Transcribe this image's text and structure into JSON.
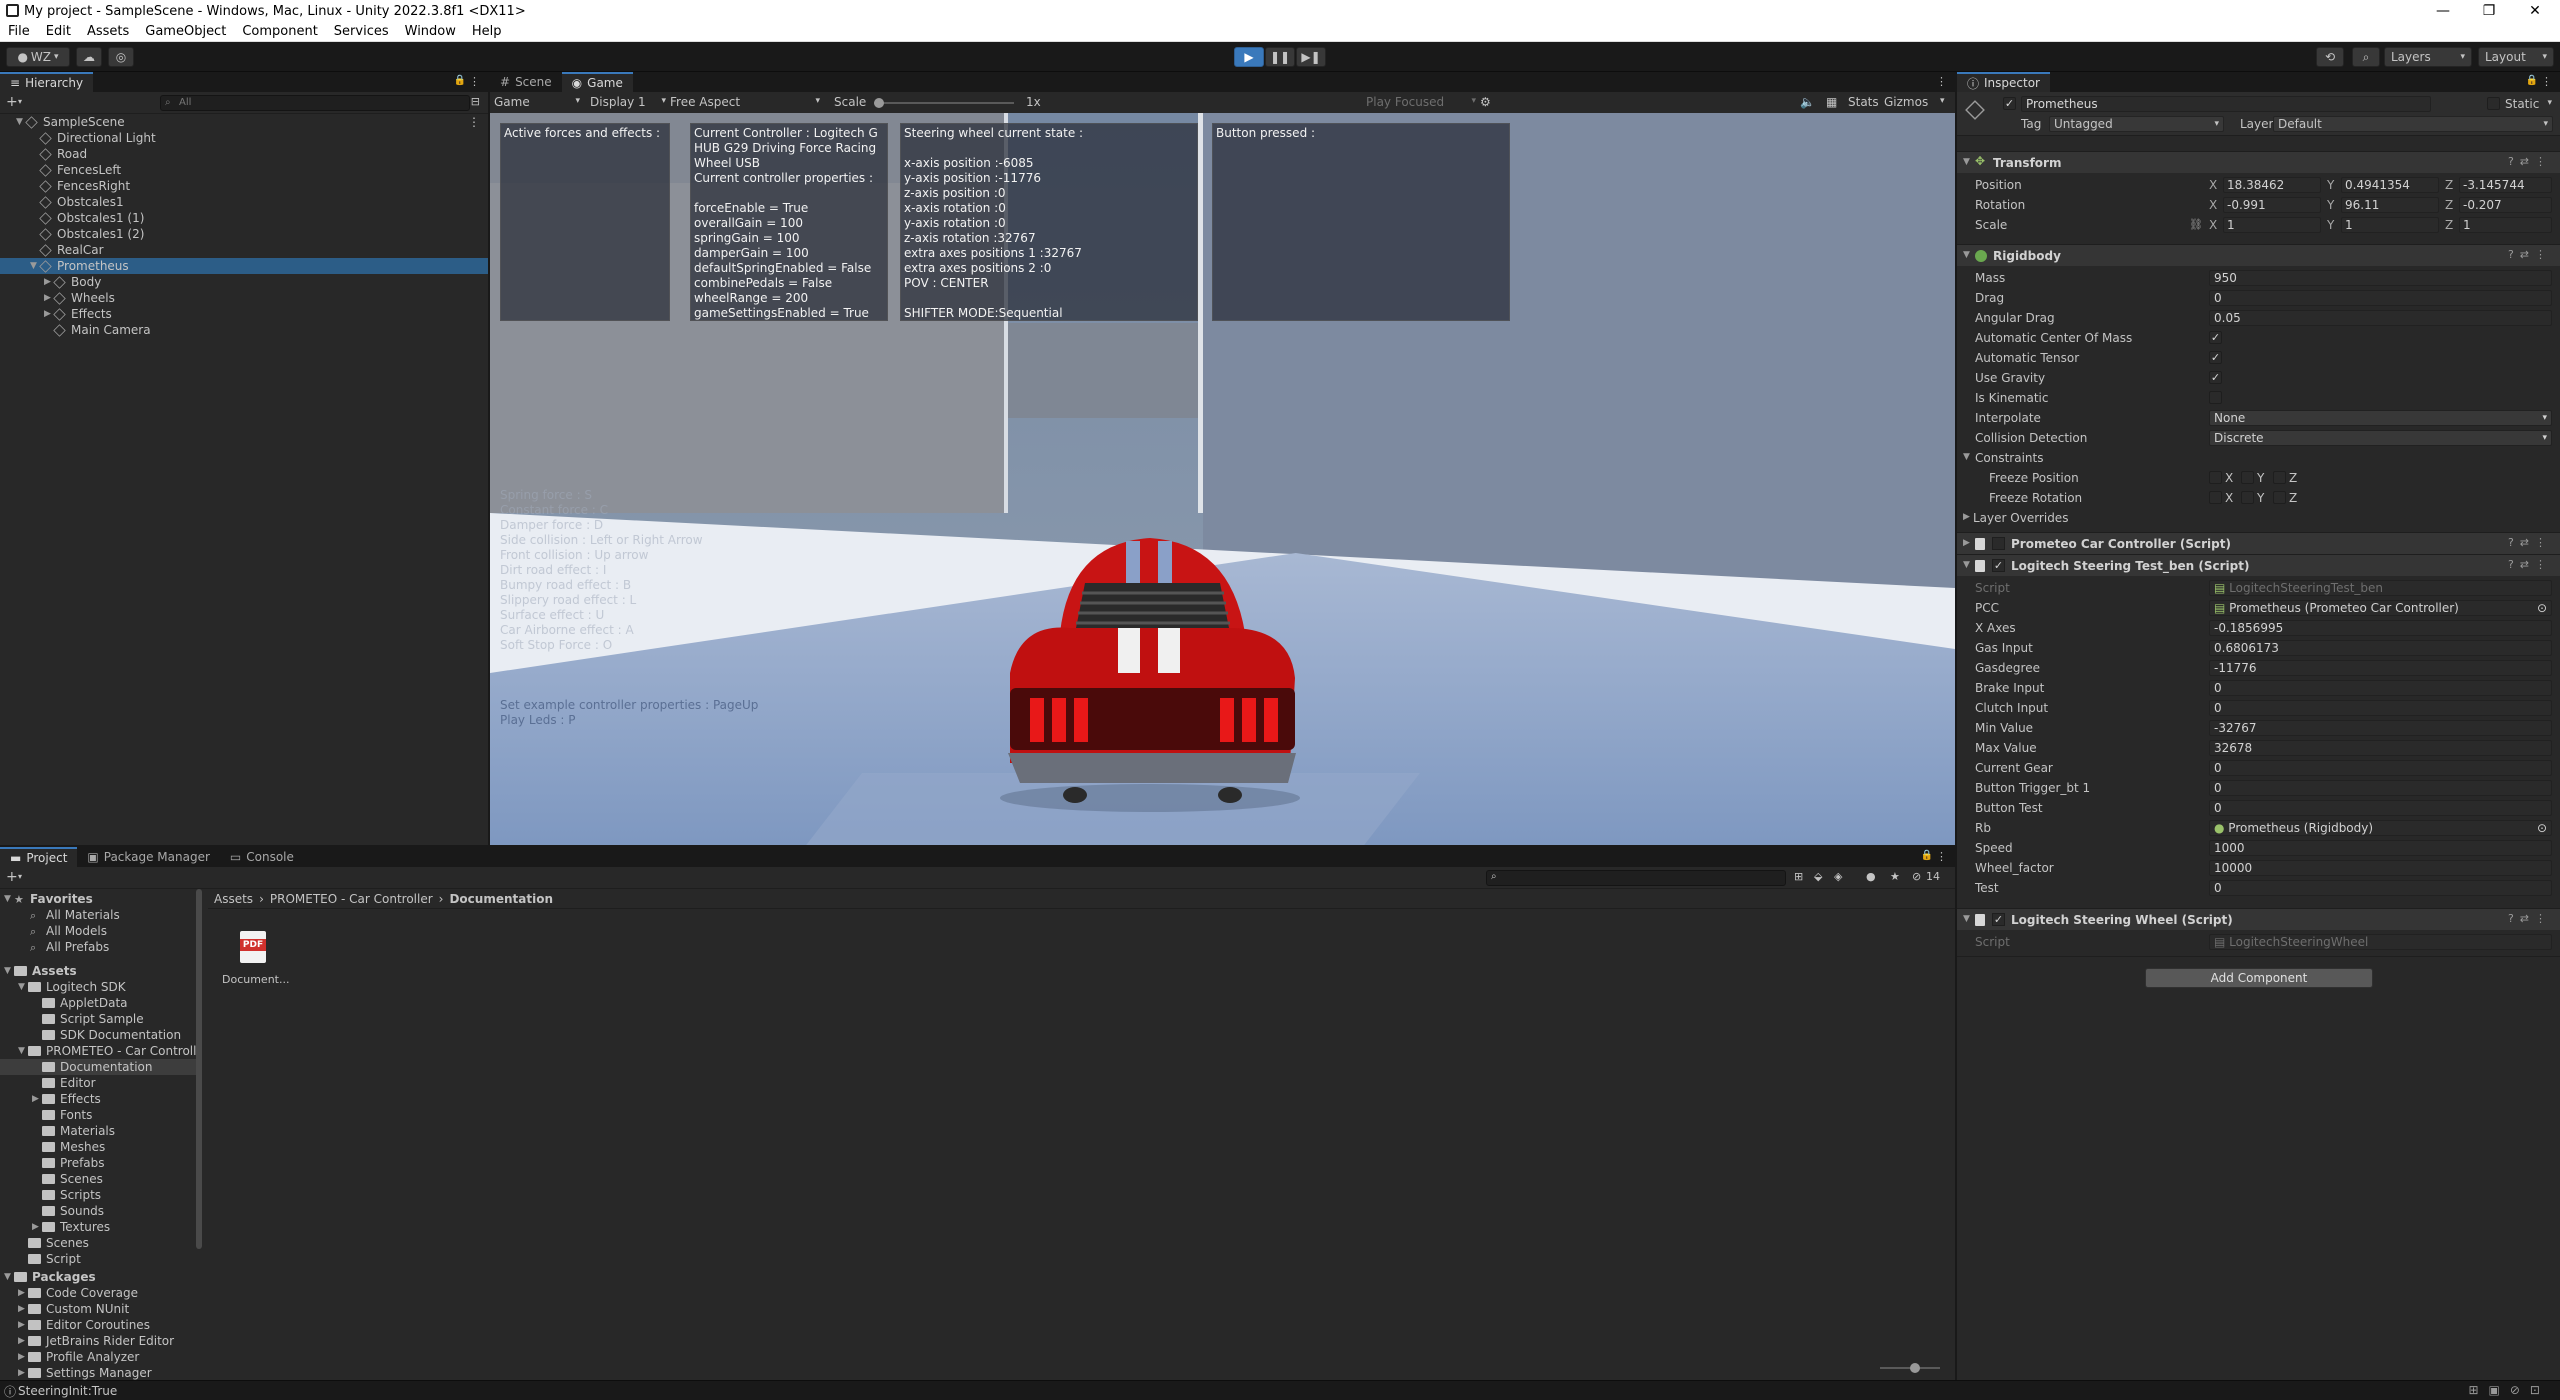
{
  "window": {
    "title": "My project - SampleScene - Windows, Mac, Linux - Unity 2022.3.8f1 <DX11>",
    "controls": [
      "—",
      "❐",
      "✕"
    ]
  },
  "menu": [
    "File",
    "Edit",
    "Assets",
    "GameObject",
    "Component",
    "Services",
    "Window",
    "Help"
  ],
  "toolbar": {
    "account": "WZ",
    "layers": "Layers",
    "layout": "Layout"
  },
  "hierarchy": {
    "tab": "Hierarchy",
    "search_placeholder": "All",
    "items": [
      {
        "label": "SampleScene",
        "depth": 0
      },
      {
        "label": "Directional Light",
        "depth": 1
      },
      {
        "label": "Road",
        "depth": 1
      },
      {
        "label": "FencesLeft",
        "depth": 1
      },
      {
        "label": "FencesRight",
        "depth": 1
      },
      {
        "label": "Obstcales1",
        "depth": 1
      },
      {
        "label": "Obstcales1 (1)",
        "depth": 1
      },
      {
        "label": "Obstcales1 (2)",
        "depth": 1
      },
      {
        "label": "RealCar",
        "depth": 1
      },
      {
        "label": "Prometheus",
        "depth": 1
      },
      {
        "label": "Body",
        "depth": 2
      },
      {
        "label": "Wheels",
        "depth": 2
      },
      {
        "label": "Effects",
        "depth": 2
      },
      {
        "label": "Main Camera",
        "depth": 2
      }
    ]
  },
  "scene_tabs": {
    "scene": "Scene",
    "game": "Game"
  },
  "game_bar": {
    "game": "Game",
    "display": "Display 1",
    "aspect": "Free Aspect",
    "scale_label": "Scale",
    "scale_value": "1x",
    "play_focused": "Play Focused",
    "stats": "Stats",
    "gizmos": "Gizmos"
  },
  "overlay": {
    "forces": "Active forces and effects :",
    "controller": "Current Controller : Logitech G\nHUB G29 Driving Force Racing\nWheel USB\nCurrent controller properties :\n\nforceEnable = True\noverallGain = 100\nspringGain = 100\ndamperGain = 100\ndefaultSpringEnabled = False\ncombinePedals = False\nwheelRange = 200\ngameSettingsEnabled = True",
    "wheel_state": "Steering wheel current state :\n\nx-axis position :-6085\ny-axis position :-11776\nz-axis position :0\nx-axis rotation :0\ny-axis rotation :0\nz-axis rotation :32767\nextra axes positions 1 :32767\nextra axes positions 2 :0\nPOV : CENTER\n\nSHIFTER MODE:Sequential",
    "button_pressed": "Button pressed :",
    "instructions_faded": "Spring force : S\nConstant force : C\nDamper force : D\nSide collision : Left or Right Arrow\nFront collision : Up arrow\nDirt road effect : I\nBumpy road effect : B\nSlippery road effect : L\nSurface effect : U\nCar Airborne effect : A\nSoft Stop Force : O",
    "instruction_1": "Set example controller properties : PageUp",
    "instruction_2": "Play Leds : P"
  },
  "inspector": {
    "tab": "Inspector",
    "object_name": "Prometheus",
    "static_label": "Static",
    "tag_label": "Tag",
    "tag_value": "Untagged",
    "layer_label": "Layer",
    "layer_value": "Default",
    "transform": {
      "title": "Transform",
      "position_label": "Position",
      "position": {
        "x": "18.38462",
        "y": "0.4941354",
        "z": "-3.145744"
      },
      "rotation_label": "Rotation",
      "rotation": {
        "x": "-0.991",
        "y": "96.11",
        "z": "-0.207"
      },
      "scale_label": "Scale",
      "scale": {
        "x": "1",
        "y": "1",
        "z": "1"
      }
    },
    "rigidbody": {
      "title": "Rigidbody",
      "mass_label": "Mass",
      "mass": "950",
      "drag_label": "Drag",
      "drag": "0",
      "angular_drag_label": "Angular Drag",
      "angular_drag": "0.05",
      "auto_com_label": "Automatic Center Of Mass",
      "auto_tensor_label": "Automatic Tensor",
      "use_gravity_label": "Use Gravity",
      "is_kinematic_label": "Is Kinematic",
      "interpolate_label": "Interpolate",
      "interpolate": "None",
      "collision_label": "Collision Detection",
      "collision": "Discrete",
      "constraints_label": "Constraints",
      "freeze_pos_label": "Freeze Position",
      "freeze_rot_label": "Freeze Rotation",
      "layer_overrides_label": "Layer Overrides",
      "axis_x": "X",
      "axis_y": "Y",
      "axis_z": "Z"
    },
    "car_controller": {
      "title": "Prometeo Car Controller (Script)"
    },
    "steering_test": {
      "title": "Logitech Steering Test_ben (Script)",
      "fields": [
        {
          "label": "Script",
          "value": "LogitechSteeringTest_ben"
        },
        {
          "label": "PCC",
          "value": "Prometheus (Prometeo Car Controller)"
        },
        {
          "label": "X Axes",
          "value": "-0.1856995"
        },
        {
          "label": "Gas Input",
          "value": "0.6806173"
        },
        {
          "label": "Gasdegree",
          "value": "-11776"
        },
        {
          "label": "Brake Input",
          "value": "0"
        },
        {
          "label": "Clutch Input",
          "value": "0"
        },
        {
          "label": "Min Value",
          "value": "-32767"
        },
        {
          "label": "Max Value",
          "value": "32678"
        },
        {
          "label": "Current Gear",
          "value": "0"
        },
        {
          "label": "Button Trigger_bt 1",
          "value": "0"
        },
        {
          "label": "Button Test",
          "value": "0"
        },
        {
          "label": "Rb",
          "value": "Prometheus (Rigidbody)"
        },
        {
          "label": "Speed",
          "value": "1000"
        },
        {
          "label": "Wheel_factor",
          "value": "10000"
        },
        {
          "label": "Test",
          "value": "0"
        }
      ]
    },
    "steering_wheel": {
      "title": "Logitech Steering Wheel (Script)",
      "script_label": "Script",
      "script_value": "LogitechSteeringWheel"
    },
    "add_component": "Add Component"
  },
  "project": {
    "tabs": [
      "Project",
      "Package Manager",
      "Console"
    ],
    "breadcrumb": [
      "Assets",
      "PROMETEO - Car Controller",
      "Documentation"
    ],
    "hidden_count": "14",
    "favorites_label": "Favorites",
    "favorites": [
      "All Materials",
      "All Models",
      "All Prefabs"
    ],
    "assets_label": "Assets",
    "tree": [
      {
        "label": "Logitech SDK",
        "depth": 1,
        "open": true
      },
      {
        "label": "AppletData",
        "depth": 2
      },
      {
        "label": "Script Sample",
        "depth": 2
      },
      {
        "label": "SDK Documentation",
        "depth": 2
      },
      {
        "label": "PROMETEO - Car Controll",
        "depth": 1,
        "open": true
      },
      {
        "label": "Documentation",
        "depth": 2,
        "sel": true
      },
      {
        "label": "Editor",
        "depth": 2
      },
      {
        "label": "Effects",
        "depth": 2,
        "closed": true
      },
      {
        "label": "Fonts",
        "depth": 2
      },
      {
        "label": "Materials",
        "depth": 2
      },
      {
        "label": "Meshes",
        "depth": 2
      },
      {
        "label": "Prefabs",
        "depth": 2
      },
      {
        "label": "Scenes",
        "depth": 2
      },
      {
        "label": "Scripts",
        "depth": 2
      },
      {
        "label": "Sounds",
        "depth": 2
      },
      {
        "label": "Textures",
        "depth": 2,
        "closed": true
      },
      {
        "label": "Scenes",
        "depth": 1
      },
      {
        "label": "Script",
        "depth": 1
      }
    ],
    "packages_label": "Packages",
    "packages": [
      "Code Coverage",
      "Custom NUnit",
      "Editor Coroutines",
      "JetBrains Rider Editor",
      "Profile Analyzer",
      "Settings Manager"
    ],
    "file": {
      "name": "Document...",
      "icon_text": "PDF"
    }
  },
  "status": {
    "message": "SteeringInit:True"
  }
}
